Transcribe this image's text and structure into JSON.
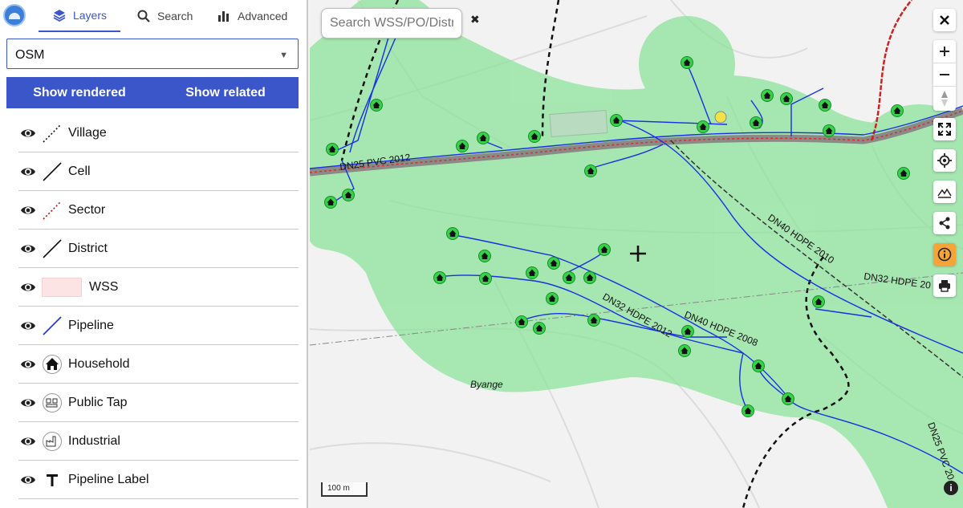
{
  "sidebar": {
    "tabs": [
      {
        "label": "Layers",
        "icon": "layers-icon",
        "active": true
      },
      {
        "label": "Search",
        "icon": "search-icon",
        "active": false
      },
      {
        "label": "Advanced",
        "icon": "bar-chart-icon",
        "active": false
      }
    ],
    "basemap": {
      "selected": "OSM"
    },
    "buttons": {
      "show_rendered": "Show rendered",
      "show_related": "Show related"
    },
    "layers": [
      {
        "label": "Village",
        "symbol": "dotted-line-icon",
        "visible": true
      },
      {
        "label": "Cell",
        "symbol": "solid-line-icon",
        "visible": true
      },
      {
        "label": "Sector",
        "symbol": "red-dotted-line-icon",
        "visible": true
      },
      {
        "label": "District",
        "symbol": "solid-line-icon",
        "visible": true
      },
      {
        "label": "WSS",
        "symbol": "pink-fill-swatch",
        "visible": true
      },
      {
        "label": "Pipeline",
        "symbol": "blue-line-icon",
        "visible": true
      },
      {
        "label": "Household",
        "symbol": "house-icon",
        "visible": true
      },
      {
        "label": "Public Tap",
        "symbol": "public-tap-icon",
        "visible": true
      },
      {
        "label": "Industrial",
        "symbol": "factory-icon",
        "visible": true
      },
      {
        "label": "Pipeline Label",
        "symbol": "text-t-icon",
        "visible": true
      }
    ]
  },
  "map": {
    "search_placeholder": "Search WSS/PO/Distric",
    "clear_symbol": "✖",
    "scale_label": "100 m",
    "place_label": "Byange",
    "pipeline_labels": [
      "DN25 PVC 2012",
      "DN40 HDPE 2010",
      "DN32 HDPE 20",
      "DN32 HDPE 2012",
      "DN40 HDPE 2008",
      "DN25 PVC 20"
    ],
    "controls": [
      "close-icon",
      "zoom-in-icon",
      "zoom-out-icon",
      "compass-icon",
      "fullscreen-icon",
      "locate-icon",
      "terrain-icon",
      "share-icon",
      "info-icon",
      "print-icon"
    ],
    "colors": {
      "accent": "#3b56c9",
      "pipeline": "#1530e6",
      "wss_area": "#8de39b",
      "info_button": "#f6a33a",
      "household": "#35d24a"
    }
  }
}
